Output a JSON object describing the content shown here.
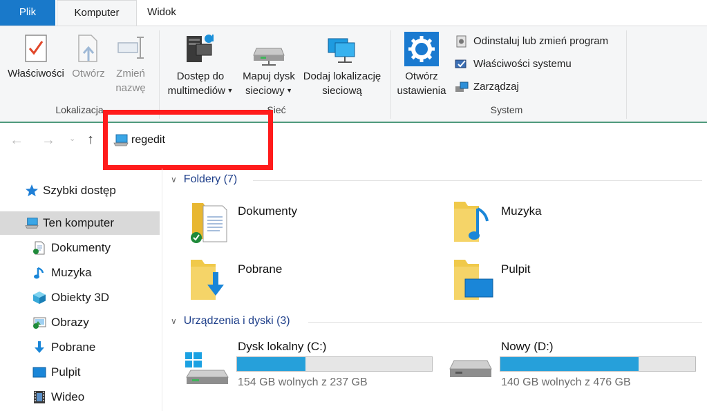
{
  "tabs": {
    "file": "Plik",
    "computer": "Komputer",
    "view": "Widok"
  },
  "ribbon": {
    "location": {
      "label": "Lokalizacja",
      "properties": "Właściwości",
      "open": "Otwórz",
      "rename_line1": "Zmień",
      "rename_line2": "nazwę"
    },
    "network": {
      "label": "Sieć",
      "media_line1": "Dostęp do",
      "media_line2": "multimediów",
      "map_line1": "Mapuj dysk",
      "map_line2": "sieciowy",
      "add_line1": "Dodaj lokalizację",
      "add_line2": "sieciową"
    },
    "system": {
      "label": "System",
      "open_settings_line1": "Otwórz",
      "open_settings_line2": "ustawienia",
      "uninstall": "Odinstaluj lub zmień program",
      "sys_props": "Właściwości systemu",
      "manage": "Zarządzaj"
    }
  },
  "address": {
    "path": "regedit"
  },
  "sidebar": {
    "items": [
      {
        "label": "Szybki dostęp"
      },
      {
        "label": "Ten komputer"
      },
      {
        "label": "Dokumenty"
      },
      {
        "label": "Muzyka"
      },
      {
        "label": "Obiekty 3D"
      },
      {
        "label": "Obrazy"
      },
      {
        "label": "Pobrane"
      },
      {
        "label": "Pulpit"
      },
      {
        "label": "Wideo"
      }
    ]
  },
  "folders": {
    "header": "Foldery (7)",
    "items": [
      {
        "name": "Dokumenty"
      },
      {
        "name": "Muzyka"
      },
      {
        "name": "Pobrane"
      },
      {
        "name": "Pulpit"
      }
    ]
  },
  "devices": {
    "header": "Urządzenia i dyski (3)",
    "items": [
      {
        "name": "Dysk lokalny (C:)",
        "free": "154 GB wolnych z 237 GB",
        "used_fraction": 0.35
      },
      {
        "name": "Nowy (D:)",
        "free": "140 GB wolnych z 476 GB",
        "used_fraction": 0.71
      }
    ]
  },
  "colors": {
    "accent": "#1979ca",
    "bar_fill": "#26a0da",
    "folder": "#f0c94a",
    "highlight_box": "#ff1b1b"
  }
}
